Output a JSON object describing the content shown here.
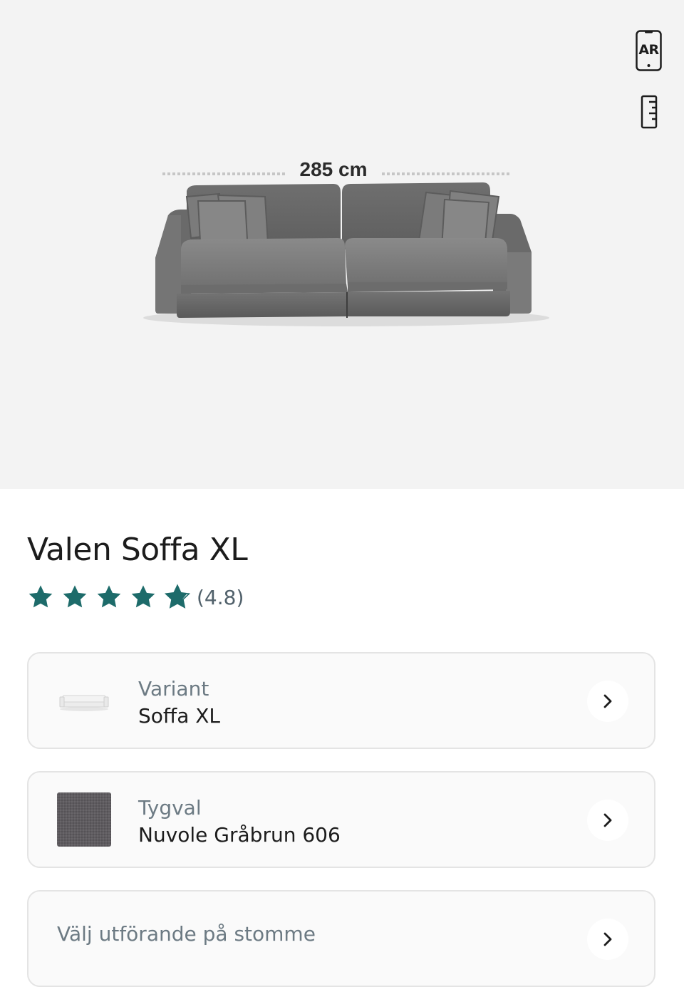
{
  "viewer": {
    "ar_label": "AR",
    "dimension_label": "285 cm"
  },
  "product": {
    "title": "Valen Soffa XL",
    "rating": 4.8,
    "rating_text": "(4.8)",
    "star_color": "#1d6b6a"
  },
  "options": [
    {
      "label": "Variant",
      "value": "Soffa XL",
      "thumb": "sofa-thumbnail"
    },
    {
      "label": "Tygval",
      "value": "Nuvole Gråbrun 606",
      "thumb": "fabric-swatch",
      "swatch_color": "#5e5b5f"
    },
    {
      "label": "Välj utförande på stomme",
      "value": ""
    }
  ]
}
